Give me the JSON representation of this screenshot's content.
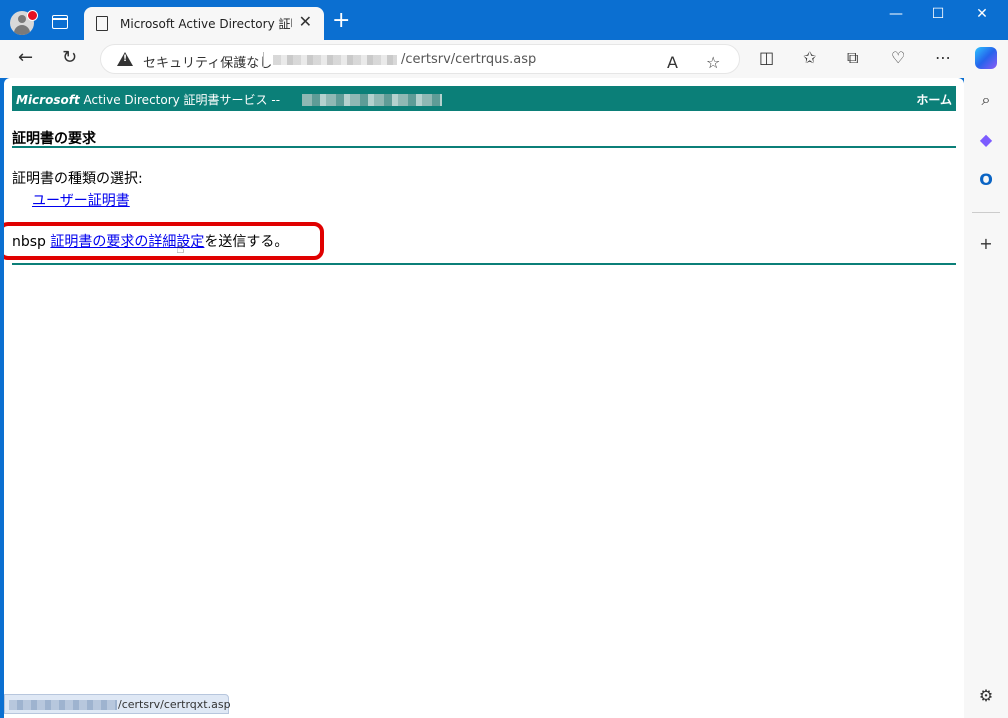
{
  "browser": {
    "tab_title": "Microsoft Active Directory 証明書",
    "tab_close": "✕",
    "new_tab": "+",
    "window_controls": {
      "minimize": "—",
      "maximize": "☐",
      "close": "✕"
    },
    "security_text": "セキュリティ保護なし",
    "url_text": "/certsrv/certrqus.asp",
    "status_url": "/certsrv/certrqxt.asp"
  },
  "page": {
    "header_prefix": "Microsoft",
    "header_title": " Active Directory 証明書サービス --",
    "home_link": "ホーム",
    "section_title": "証明書の要求",
    "choose_label": "証明書の種類の選択:",
    "user_cert_link": "ユーザー証明書",
    "advanced_prefix": "nbsp ",
    "advanced_link": "証明書の要求の詳細設定",
    "advanced_suffix": "を送信する。"
  },
  "colors": {
    "accent": "#0b7f78",
    "titlebar": "#0b6fd1",
    "highlight": "#e00000",
    "link": "#0000ee"
  },
  "icons": [
    "profile-avatar-icon",
    "tab-actions-icon",
    "document-icon",
    "back-icon",
    "refresh-icon",
    "warning-icon",
    "read-aloud-icon",
    "favorite-star-icon",
    "split-screen-icon",
    "favorites-icon",
    "collections-icon",
    "browser-essentials-icon",
    "more-icon",
    "copilot-icon",
    "search-icon",
    "copilot-side-icon",
    "outlook-icon",
    "add-icon",
    "settings-icon",
    "hand-cursor-icon"
  ]
}
